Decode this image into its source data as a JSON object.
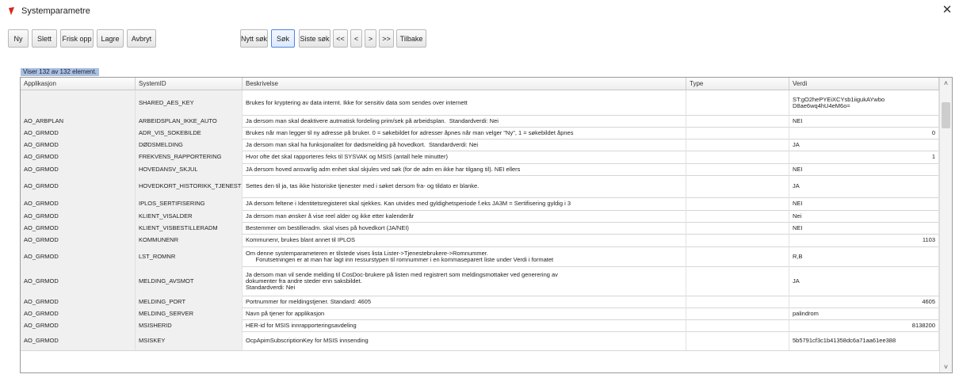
{
  "window": {
    "title": "Systemparametre",
    "close_icon": "close-icon"
  },
  "toolbar": {
    "buttons": [
      "Ny",
      "Slett",
      "Frisk opp",
      "Lagre",
      "Avbryt",
      "Nytt søk",
      "Søk",
      "Siste søk",
      "<<",
      "<",
      ">",
      ">>",
      "Tilbake"
    ]
  },
  "status": "Viser 132 av 132 element.",
  "table": {
    "headers": [
      "Applikasjon",
      "SystemID",
      "Beskrivelse",
      "Type",
      "Verdi"
    ],
    "rows": [
      {
        "app": "",
        "sys": "SHARED_AES_KEY",
        "desc": "Brukes for kryptering av data internt. Ikke for sensitiv data som sendes over internett",
        "type": "",
        "verdi": "ST:gO2hePYEiXCYsb1iigukAYwbo D8ae6wq4hU4eM6o=",
        "num": false
      },
      {
        "app": "AO_ARBPLAN",
        "sys": "ARBEIDSPLAN_IKKE_AUTO",
        "desc": "Ja dersom man skal deaktivere autmatisk fordeling prim/sek på arbeidsplan.  Standardverdi: Nei",
        "type": "",
        "verdi": "NEI",
        "num": false
      },
      {
        "app": "AO_GRMOD",
        "sys": "ADR_VIS_SOKEBILDE",
        "desc": "Brukes når man legger til ny adresse på bruker. 0 = søkebildet for adresser åpnes når man velger \"Ny\", 1 = søkebildet åpnes",
        "type": "",
        "verdi": "0",
        "num": true
      },
      {
        "app": "AO_GRMOD",
        "sys": "DØDSMELDING",
        "desc": "Ja dersom man skal ha funksjonalitet for dødsmelding på hovedkort.  Standardverdi: Nei",
        "type": "",
        "verdi": "JA",
        "num": false
      },
      {
        "app": "AO_GRMOD",
        "sys": "FREKVENS_RAPPORTERING",
        "desc": "Hvor ofte det skal rapporteres feks til SYSVAK og MSIS (antall hele minutter)",
        "type": "",
        "verdi": "1",
        "num": true
      },
      {
        "app": "AO_GRMOD",
        "sys": "HOVEDANSV_SKJUL",
        "desc": "JA dersom hoved ansvarlig adm enhet skal skjules ved søk (for de adm en ikke har tilgang til). NEI ellers",
        "type": "",
        "verdi": "NEI",
        "num": false
      },
      {
        "app": "AO_GRMOD",
        "sys": "HOVEDKORT_HISTORIKK_TJENESTER_&FIKS",
        "desc": "Settes den til ja, tas ikke historiske tjenester med i søket dersom fra- og tildato er blanke.",
        "type": "",
        "verdi": "JA",
        "num": false
      },
      {
        "app": "AO_GRMOD",
        "sys": "IPLOS_SERTIFISERING",
        "desc": "JA dersom feltene i Identitetsregisteret skal sjekkes. Kan utvides med gyldighetsperiode f.eks JA3M = Sertifisering gyldig i 3",
        "type": "",
        "verdi": "NEI",
        "num": false
      },
      {
        "app": "AO_GRMOD",
        "sys": "KLIENT_VISALDER",
        "desc": "Ja dersom man ønsker å vise reel alder og ikke etter kalenderår",
        "type": "",
        "verdi": "Nei",
        "num": false
      },
      {
        "app": "AO_GRMOD",
        "sys": "KLIENT_VISBESTILLERADM",
        "desc": "Bestemmer om bestilleradm. skal vises på hovedkort (JA/NEI)",
        "type": "",
        "verdi": "NEI",
        "num": false
      },
      {
        "app": "AO_GRMOD",
        "sys": "KOMMUNENR",
        "desc": "Kommunenr, brukes blant annet til IPLOS",
        "type": "",
        "verdi": "1103",
        "num": true
      },
      {
        "app": "AO_GRMOD",
        "sys": "LST_ROMNR",
        "desc": "Om denne systemparameteren er tilstede vises lista Lister->Tjenestebrukere->Romnummer.\n      Forutsetningen er at man har lagt inn ressurstypen til romnummer i en kommaseparert liste under Verdi i formatet",
        "type": "",
        "verdi": "R,B",
        "num": false
      },
      {
        "app": "AO_GRMOD",
        "sys": "MELDING_AVSMOT",
        "desc": "Ja dersom man vil sende melding til CosDoc-brukere på listen med registrert som meldingsmottaker ved generering av\ndokumenter fra andre steder enn saksbildet.\nStandardverdi: Nei",
        "type": "",
        "verdi": "JA",
        "num": false
      },
      {
        "app": "AO_GRMOD",
        "sys": "MELDING_PORT",
        "desc": "Portnummer for meldingstjener. Standard: 4605",
        "type": "",
        "verdi": "4605",
        "num": true
      },
      {
        "app": "AO_GRMOD",
        "sys": "MELDING_SERVER",
        "desc": "Navn på tjener for applikasjon",
        "type": "",
        "verdi": "palindrom",
        "num": false
      },
      {
        "app": "AO_GRMOD",
        "sys": "MSISHERID",
        "desc": "HER-id for MSIS innrapporteringsavdeling",
        "type": "",
        "verdi": "8138200",
        "num": true
      },
      {
        "app": "AO_GRMOD",
        "sys": "MSISKEY",
        "desc": "OcpApimSubscriptionKey for MSIS innsending",
        "type": "",
        "verdi": "5b5791cf3c1b41358dc6a71aa61ee388",
        "num": false
      }
    ]
  }
}
